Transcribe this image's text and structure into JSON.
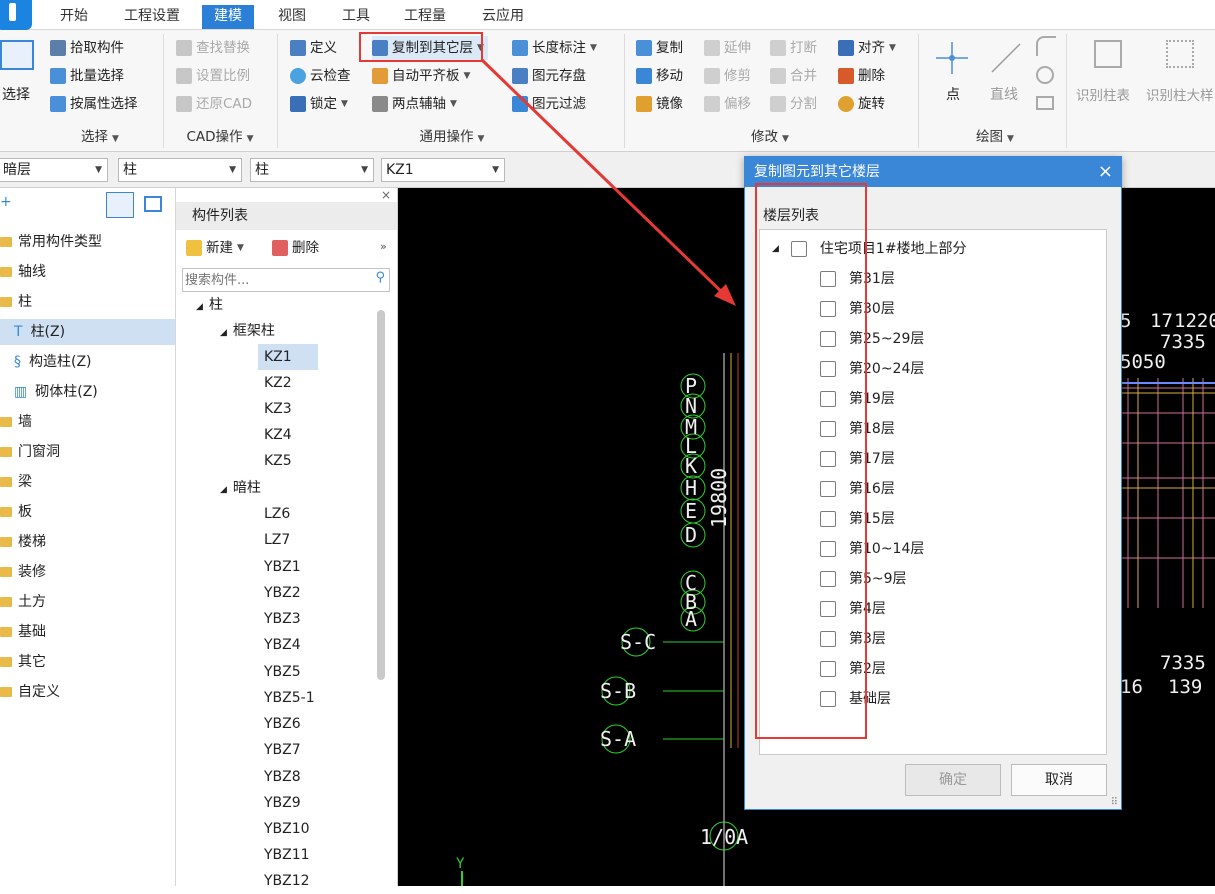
{
  "tabs": [
    "开始",
    "工程设置",
    "建模",
    "视图",
    "工具",
    "工程量",
    "云应用"
  ],
  "ribbon": {
    "select_big": "选择",
    "select_items": [
      "拾取构件",
      "批量选择",
      "按属性选择"
    ],
    "select_group": "选择",
    "cad_items": [
      "查找替换",
      "设置比例",
      "还原CAD"
    ],
    "cad_group": "CAD操作",
    "gen_col1": [
      "定义",
      "云检查",
      "锁定"
    ],
    "gen_col2": [
      "复制到其它层",
      "自动平齐板",
      "两点辅轴"
    ],
    "gen_col3": [
      "长度标注",
      "图元存盘",
      "图元过滤"
    ],
    "gen_group": "通用操作",
    "mod_col1": [
      "复制",
      "移动",
      "镜像"
    ],
    "mod_col2": [
      "延伸",
      "修剪",
      "偏移"
    ],
    "mod_col3": [
      "打断",
      "合并",
      "分割"
    ],
    "mod_col4": [
      "对齐",
      "删除",
      "旋转"
    ],
    "mod_group": "修改",
    "draw_point": "点",
    "draw_line": "直线",
    "draw_group": "绘图",
    "recog1": "识别柱表",
    "recog2": "识别柱大样"
  },
  "selectors": [
    "暗层",
    "柱",
    "柱",
    "KZ1"
  ],
  "tree": {
    "items": [
      "常用构件类型",
      "轴线",
      "柱",
      "柱(Z)",
      "构造柱(Z)",
      "砌体柱(Z)",
      "墙",
      "门窗洞",
      "梁",
      "板",
      "楼梯",
      "装修",
      "土方",
      "基础",
      "其它",
      "自定义"
    ]
  },
  "complist": {
    "title": "构件列表",
    "new_label": "新建",
    "delete_label": "删除",
    "search_placeholder": "搜索构件...",
    "items": [
      "柱",
      "框架柱",
      "KZ1",
      "KZ2",
      "KZ3",
      "KZ4",
      "KZ5",
      "暗柱",
      "LZ6",
      "LZ7",
      "YBZ1",
      "YBZ2",
      "YBZ3",
      "YBZ4",
      "YBZ5",
      "YBZ5-1",
      "YBZ6",
      "YBZ7",
      "YBZ8",
      "YBZ9",
      "YBZ10",
      "YBZ11",
      "YBZ12"
    ]
  },
  "cad": {
    "axis_right": [
      "P",
      "N",
      "M",
      "L",
      "K",
      "H",
      "E",
      "D"
    ],
    "axis_low": [
      "C",
      "B",
      "A"
    ],
    "axis_s": [
      "S-C",
      "S-B",
      "S-A"
    ],
    "dim_vertical": "19800",
    "label_bottom": "1/0A",
    "label_y": "Y",
    "right_nums": [
      "5",
      "17",
      "1220",
      "7335",
      "5050",
      "16",
      "139",
      "7335"
    ]
  },
  "dialog": {
    "title": "复制图元到其它楼层",
    "close": "×",
    "list_label": "楼层列表",
    "project": "住宅项目1#楼地上部分",
    "floors": [
      "第31层",
      "第30层",
      "第25~29层",
      "第20~24层",
      "第19层",
      "第18层",
      "第17层",
      "第16层",
      "第15层",
      "第10~14层",
      "第5~9层",
      "第4层",
      "第3层",
      "第2层",
      "基础层"
    ],
    "ok": "确定",
    "cancel": "取消"
  },
  "colors": {
    "accent": "#2b7fd6",
    "dialog_title": "#3a87d8",
    "highlight": "#e53935",
    "cad_bg": "#000000",
    "cad_green": "#2fd12f"
  }
}
